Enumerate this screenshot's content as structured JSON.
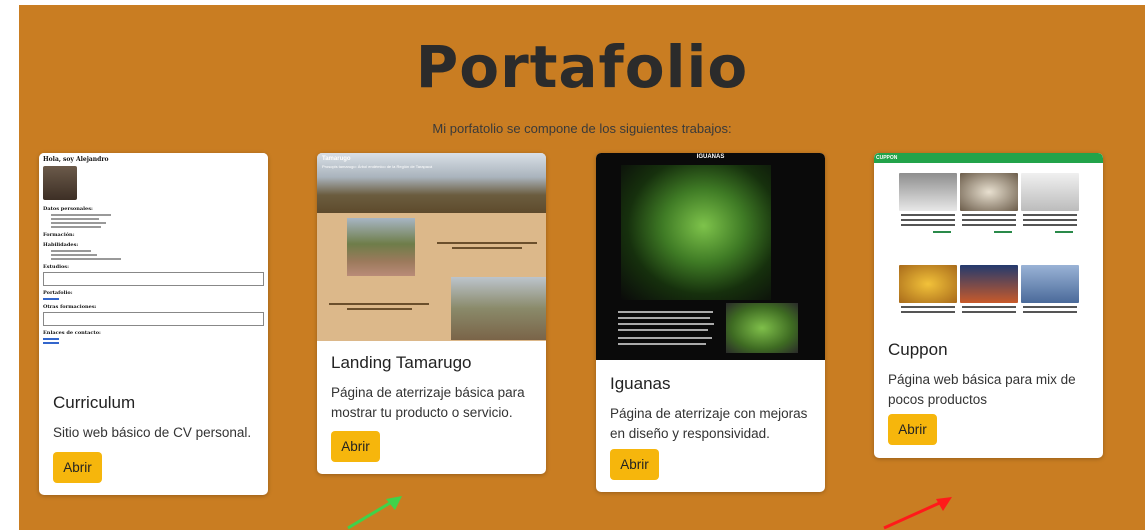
{
  "section": {
    "title": "Portafolio",
    "subtitle": "Mi porfatolio se compone de los siguientes trabajos:"
  },
  "cards": [
    {
      "title": "Curriculum",
      "text": "Sitio web básico de CV personal.",
      "button": "Abrir"
    },
    {
      "title": "Landing Tamarugo",
      "text": "Página de aterrizaje básica para mostrar tu producto o servicio.",
      "button": "Abrir"
    },
    {
      "title": "Iguanas",
      "text": "Página de aterrizaje con mejoras en diseño y responsividad.",
      "button": "Abrir"
    },
    {
      "title": "Cuppon",
      "text": "Página web básica para mix de pocos productos",
      "button": "Abrir"
    }
  ],
  "thumbs": {
    "cv_heading": "Hola, soy Alejandro",
    "cv_sections": [
      "Datos personales:",
      "Formación:",
      "Habilidades:",
      "Estudios:",
      "Portafolio:",
      "Otras formaciones:",
      "Enlaces de contacto:"
    ],
    "tamarugo_title": "Tamarugo",
    "tamarugo_sub": "Prosopis tamarugo: Árbol endémico de la Región de Tarapacá",
    "iguanas_title": "IGUANAS",
    "cuppon_brand": "CUPPON"
  },
  "colors": {
    "section_bg": "#c97d22",
    "button": "#f6b60c",
    "arrow_green": "#3fd24a",
    "arrow_red": "#ff1a1a"
  },
  "icons": [
    "green-arrow-icon",
    "red-arrow-icon"
  ]
}
